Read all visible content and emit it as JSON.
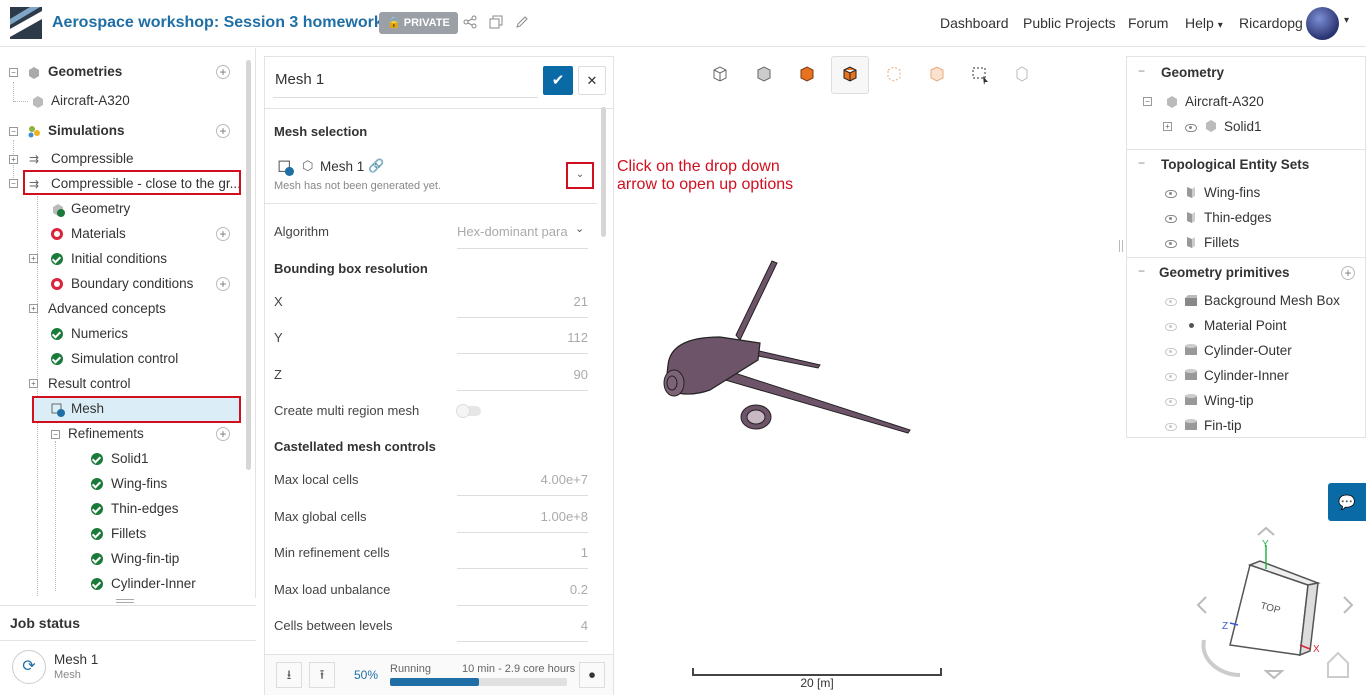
{
  "header": {
    "title": "Aerospace workshop: Session 3 homework",
    "badge": "PRIVATE",
    "nav": [
      "Dashboard",
      "Public Projects",
      "Forum",
      "Help"
    ],
    "user": "Ricardopg"
  },
  "tree": {
    "geometries": "Geometries",
    "geometry_item": "Aircraft-A320",
    "simulations": "Simulations",
    "sim1": "Compressible",
    "sim2": "Compressible - close to the gr...",
    "items": [
      "Geometry",
      "Materials",
      "Initial conditions",
      "Boundary conditions",
      "Advanced concepts",
      "Numerics",
      "Simulation control",
      "Result control",
      "Mesh",
      "Refinements"
    ],
    "refinements": [
      "Solid1",
      "Wing-fins",
      "Thin-edges",
      "Fillets",
      "Wing-fin-tip",
      "Cylinder-Inner"
    ]
  },
  "job_status": {
    "title": "Job status",
    "name": "Mesh 1",
    "type": "Mesh"
  },
  "panel": {
    "name": "Mesh 1",
    "mesh_selection_label": "Mesh selection",
    "mesh_name": "Mesh 1",
    "mesh_note": "Mesh has not been generated yet.",
    "algorithm_label": "Algorithm",
    "algorithm_value": "Hex-dominant para",
    "bbox_label": "Bounding box resolution",
    "x_label": "X",
    "x_value": "21",
    "y_label": "Y",
    "y_value": "112",
    "z_label": "Z",
    "z_value": "90",
    "multi_label": "Create multi region mesh",
    "castellated_label": "Castellated mesh controls",
    "max_local_label": "Max local cells",
    "max_local_value": "4.00e+7",
    "max_global_label": "Max global cells",
    "max_global_value": "1.00e+8",
    "min_ref_label": "Min refinement cells",
    "min_ref_value": "1",
    "max_load_label": "Max load unbalance",
    "max_load_value": "0.2",
    "cells_between_label": "Cells between levels",
    "cells_between_value": "4",
    "progress_percent": "50%",
    "progress": 0.5,
    "status": "Running",
    "time": "10 min - 2.9 core hours"
  },
  "annotation": "Click on the drop down arrow to open up options",
  "scale_label": "20 [m]",
  "right": {
    "geometry": "Geometry",
    "geom_item": "Aircraft-A320",
    "geom_sub": "Solid1",
    "topo": "Topological Entity Sets",
    "topo_items": [
      "Wing-fins",
      "Thin-edges",
      "Fillets"
    ],
    "prims": "Geometry primitives",
    "prim_items": [
      "Background Mesh Box",
      "Material Point",
      "Cylinder-Outer",
      "Cylinder-Inner",
      "Wing-tip",
      "Fin-tip"
    ]
  },
  "viewcube": {
    "face": "TOP",
    "x": "X",
    "y": "Y",
    "z": "Z"
  },
  "colors": {
    "brand": "#1f6fa6",
    "accent": "#0a6aa6",
    "ok": "#1a7a3a",
    "warn": "#d9253b",
    "highlight": "#d10f1f",
    "airplane": "#6e5468"
  }
}
